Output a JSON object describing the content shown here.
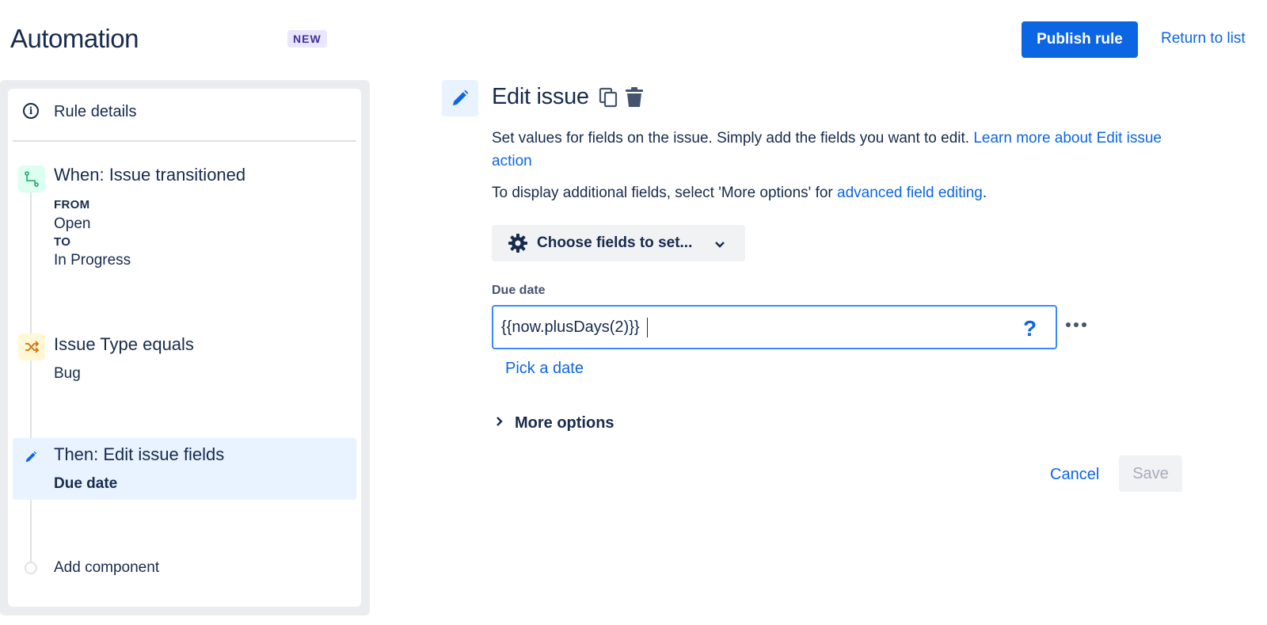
{
  "header": {
    "title": "Automation",
    "badge": "NEW",
    "publish_label": "Publish rule",
    "return_label": "Return to list"
  },
  "sidebar": {
    "rule_details_label": "Rule details",
    "trigger": {
      "title": "When: Issue transitioned",
      "from_label": "FROM",
      "from_value": "Open",
      "to_label": "TO",
      "to_value": "In Progress"
    },
    "condition": {
      "title": "Issue Type equals",
      "value": "Bug"
    },
    "action": {
      "title": "Then: Edit issue fields",
      "value": "Due date"
    },
    "add_component_label": "Add component"
  },
  "panel": {
    "title": "Edit issue",
    "description": "Set values for fields on the issue. Simply add the fields you want to edit.",
    "learn_more_link": "Learn more about Edit issue action",
    "advanced_prefix": "To display additional fields, select 'More options' for",
    "advanced_link": "advanced field editing",
    "advanced_suffix": ".",
    "choose_fields_label": "Choose fields to set...",
    "due_date_label": "Due date",
    "due_date_value": "{{now.plusDays(2)}}",
    "help_symbol": "?",
    "pick_date_label": "Pick a date",
    "more_options_label": "More options",
    "cancel_label": "Cancel",
    "save_label": "Save"
  },
  "colors": {
    "accent": "#0c66e4",
    "selected_bg": "#e9f2ff",
    "trigger_icon": "#22a06b",
    "condition_icon": "#d97008"
  },
  "icons": {
    "rule_details": "info-icon",
    "trigger": "transition-icon",
    "condition": "shuffle-icon",
    "action": "pencil-icon",
    "copy": "copy-icon",
    "delete": "trash-icon",
    "choose_fields": "gear-icon",
    "more_options": "chevron-right-icon"
  }
}
